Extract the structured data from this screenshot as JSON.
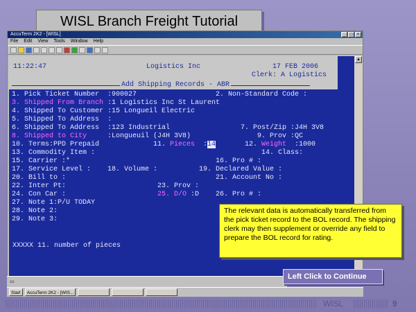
{
  "slide": {
    "title": "WISL Branch Freight Tutorial",
    "continue_label": "Left Click to Continue",
    "footer_brand": "WISL",
    "page_number": "9"
  },
  "window": {
    "title": "AccuTerm 2K2 - [WISL]",
    "menu": [
      "File",
      "Edit",
      "View",
      "Tools",
      "Window",
      "Help"
    ]
  },
  "terminal": {
    "time": "11:22:47",
    "company": "Logistics Inc",
    "date": "17 FEB 2006",
    "clerk": "Clerk: A Logistics",
    "screen_title": "Add Shipping Records - ABR",
    "rows": [
      {
        "a": "1. Pick Ticket Number  :900027",
        "b": "2. Non-Standard Code :"
      },
      {
        "a_label": "3. Shipped From Branch",
        "a_value": ":1 Logistics Inc St Laurent"
      },
      {
        "a": "4. Shipped To Customer :15 Longueil Electric"
      },
      {
        "a": "5. Shipped To Address  :"
      },
      {
        "a": "6. Shipped To Address  :123 Industrial",
        "b": "7. Post/Zip :J4H 3V8"
      },
      {
        "a_label": "8. Shipped to City",
        "a_value": "   :Longueuil (J4H 3V8)",
        "b": "9. Prov :QC"
      },
      {
        "a": "10. Terms:PPD Prepaid",
        "pieces_label": "11. Pieces",
        "pieces_value": "14",
        "weight_label": "12. Weight",
        "weight_value": ":1000"
      },
      {
        "a": "13. Commodity Item :",
        "b": "14. Class:"
      },
      {
        "a": "15. Carrier :*",
        "b": "16. Pro # :"
      },
      {
        "a": "17. Service Level :",
        "mid": "18. Volume :",
        "b": "19. Declared Value :"
      },
      {
        "a": "20. Bill to :",
        "b": "21. Account No :"
      },
      {
        "a": "22. Inter Pt:",
        "mid": "23. Prov :"
      },
      {
        "a": "24. Con Car :",
        "mid_label": "25. D/O",
        "mid_value": " :D",
        "b": "26. Pro # :"
      },
      {
        "a": "27. Note 1:P/U TODAY"
      },
      {
        "a": "28. Note 2:"
      },
      {
        "a": "29. Note 3:"
      }
    ],
    "status_message": "XXXXX 11. number of pieces"
  },
  "callout": {
    "text": "The relevant data is automatically transferred from the pick ticket record to the BOL record. The shipping clerk may then supplement or override any field to prepare the BOL record for rating."
  },
  "taskbar": [
    "Start",
    "AccuTerm 2K2 - [WIS...",
    "",
    "",
    ""
  ],
  "colors": {
    "terminal_bg": "#1a2a9a",
    "highlight": "#ff66ff",
    "callout_bg": "#ffff33"
  }
}
